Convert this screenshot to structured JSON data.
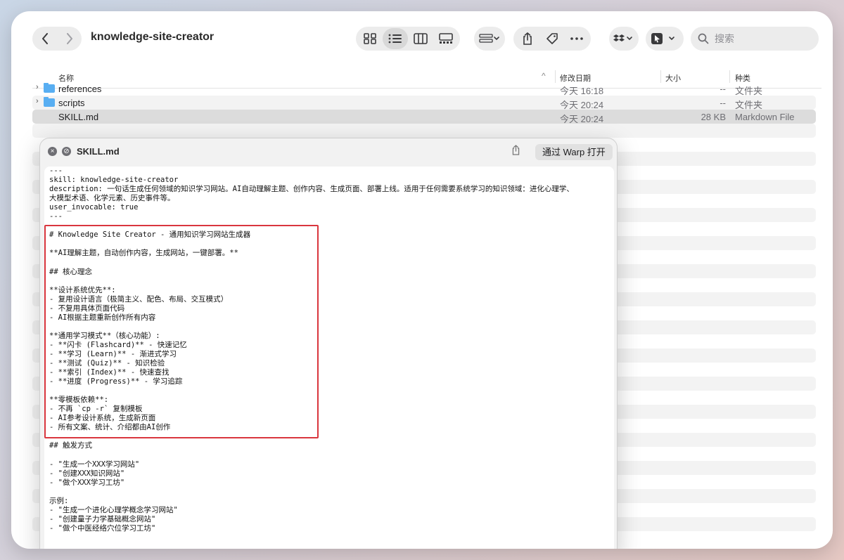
{
  "window": {
    "title": "knowledge-site-creator",
    "search_placeholder": "搜索"
  },
  "icons": {
    "back": "chevron-left-icon",
    "forward": "chevron-right-icon",
    "views": [
      "icon-view-icon",
      "list-view-icon",
      "column-view-icon",
      "gallery-view-icon"
    ],
    "group": "group-icon",
    "share": "share-icon",
    "tag": "tag-icon",
    "more": "ellipsis-icon",
    "dropbox": "dropbox-icon",
    "select": "cursor-select-icon",
    "search": "search-icon"
  },
  "columns": {
    "name": "名称",
    "date": "修改日期",
    "size": "大小",
    "kind": "种类"
  },
  "files": [
    {
      "name": "references",
      "date": "今天 16:18",
      "size": "--",
      "kind": "文件夹",
      "is_folder": true
    },
    {
      "name": "scripts",
      "date": "今天 20:24",
      "size": "--",
      "kind": "文件夹",
      "is_folder": true
    },
    {
      "name": "SKILL.md",
      "date": "今天 20:24",
      "size": "28 KB",
      "kind": "Markdown File",
      "is_folder": false
    }
  ],
  "quicklook": {
    "title": "SKILL.md",
    "open_button": "通过 Warp 打开",
    "content": "---\nskill: knowledge-site-creator\ndescription: 一句话生成任何领域的知识学习网站。AI自动理解主题、创作内容、生成页面、部署上线。适用于任何需要系统学习的知识领域：进化心理学、\n大模型术语、化学元素、历史事件等。\nuser_invocable: true\n---\n\n# Knowledge Site Creator - 通用知识学习网站生成器\n\n**AI理解主题，自动创作内容，生成网站，一键部署。**\n\n## 核心理念\n\n**设计系统优先**:\n- 复用设计语言（极简主义、配色、布局、交互模式）\n- 不复用具体页面代码\n- AI根据主题重新创作所有内容\n\n**通用学习模式**（核心功能）:\n- **闪卡 (Flashcard)** - 快速记忆\n- **学习 (Learn)** - 渐进式学习\n- **测试 (Quiz)** - 知识检验\n- **索引 (Index)** - 快速查找\n- **进度 (Progress)** - 学习追踪\n\n**零模板依赖**:\n- 不再 `cp -r` 复制模板\n- AI参考设计系统，生成新页面\n- 所有文案、统计、介绍都由AI创作\n\n## 触发方式\n\n- \"生成一个XXX学习网站\"\n- \"创建XXX知识网站\"\n- \"做个XXX学习工坊\"\n\n示例:\n- \"生成一个进化心理学概念学习网站\"\n- \"创建量子力学基础概念网站\"\n- \"做个中医经络穴位学习工坊\""
  }
}
